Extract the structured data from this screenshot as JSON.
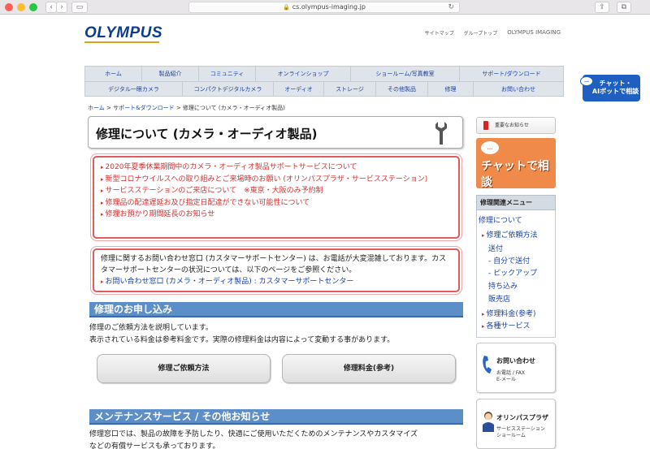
{
  "browser": {
    "url": "cs.olympus-imaging.jp",
    "back": "‹",
    "forward": "›"
  },
  "header": {
    "logo": "OLYMPUS",
    "links": [
      "サイトマップ",
      "グループトップ"
    ],
    "brand": "OLYMPUS IMAGING"
  },
  "nav": {
    "row1": [
      "ホーム",
      "製品紹介",
      "コミュニティ",
      "オンラインショップ",
      "ショールーム/写真教室",
      "サポート/ダウンロード"
    ],
    "row2": [
      "デジタル一眼カメラ",
      "コンパクトデジタルカメラ",
      "オーディオ",
      "ストレージ",
      "その他製品",
      "修理",
      "お問い合わせ"
    ]
  },
  "breadcrumb": {
    "home": "ホーム",
    "sep": " > ",
    "support": "サポート&ダウンロード",
    "current": "修理について (カメラ・オーディオ製品)"
  },
  "page_title": "修理について (カメラ・オーディオ製品)",
  "notices": [
    "2020年夏季休業期間中のカメラ・オーディオ製品サポートサービスについて",
    "新型コロナウイルスへの取り組みとご来場時のお願い (オリンパスプラザ・サービスステーション)",
    "サービスステーションのご来店について　※東京・大阪のみ予約制",
    "修理品の配達遅延お及び指定日配達ができない可能性について",
    "修理お預かり期間延長のお知らせ"
  ],
  "contact_box": {
    "text": "修理に関するお問い合わせ窓口 (カスタマーサポートセンター) は、お電話が大変混雑しております。カスタマーサポートセンターの状況については、以下のページをご参照ください。",
    "link": "お問い合わせ窓口 (カメラ・オーディオ製品) : カスタマーサポートセンター"
  },
  "section_apply": {
    "heading": "修理のお申し込み",
    "line1": "修理のご依頼方法を説明しています。",
    "line2": "表示されている料金は参考料金です。実際の修理料金は内容によって変動する事があります。",
    "btn_method": "修理ご依頼方法",
    "btn_fee": "修理料金(参考)"
  },
  "section_maint": {
    "heading": "メンテナンスサービス / その他お知らせ",
    "line1": "修理窓口では、製品の故障を予防したり、快適にご使用いただくためのメンテナンスやカスタマイズ",
    "line2": "などの有償サービスも承っております。"
  },
  "sidebar": {
    "notice": "重要なお知らせ",
    "chat_banner": "チャットで相談",
    "chat_bubble": "…",
    "menu_title": "修理関連メニュー",
    "menu": {
      "about": "修理について",
      "request": "修理ご依頼方法",
      "send": "送付",
      "self_send": "- 自分で送付",
      "pickup": "- ピックアップ",
      "bring": "持ち込み",
      "store": "販売店",
      "fee": "修理料金(参考)",
      "services": "各種サービス"
    },
    "contact_card": {
      "title": "お問い合わせ",
      "sub1": "お電話 / FAX",
      "sub2": "E-メール"
    },
    "plaza_card": {
      "title": "オリンパスプラザ",
      "sub1": "サービスステーション",
      "sub2": "ショールーム"
    }
  },
  "float_chat": {
    "line1": "チャット・",
    "line2": "AIボットで相談",
    "bubble": "…"
  }
}
